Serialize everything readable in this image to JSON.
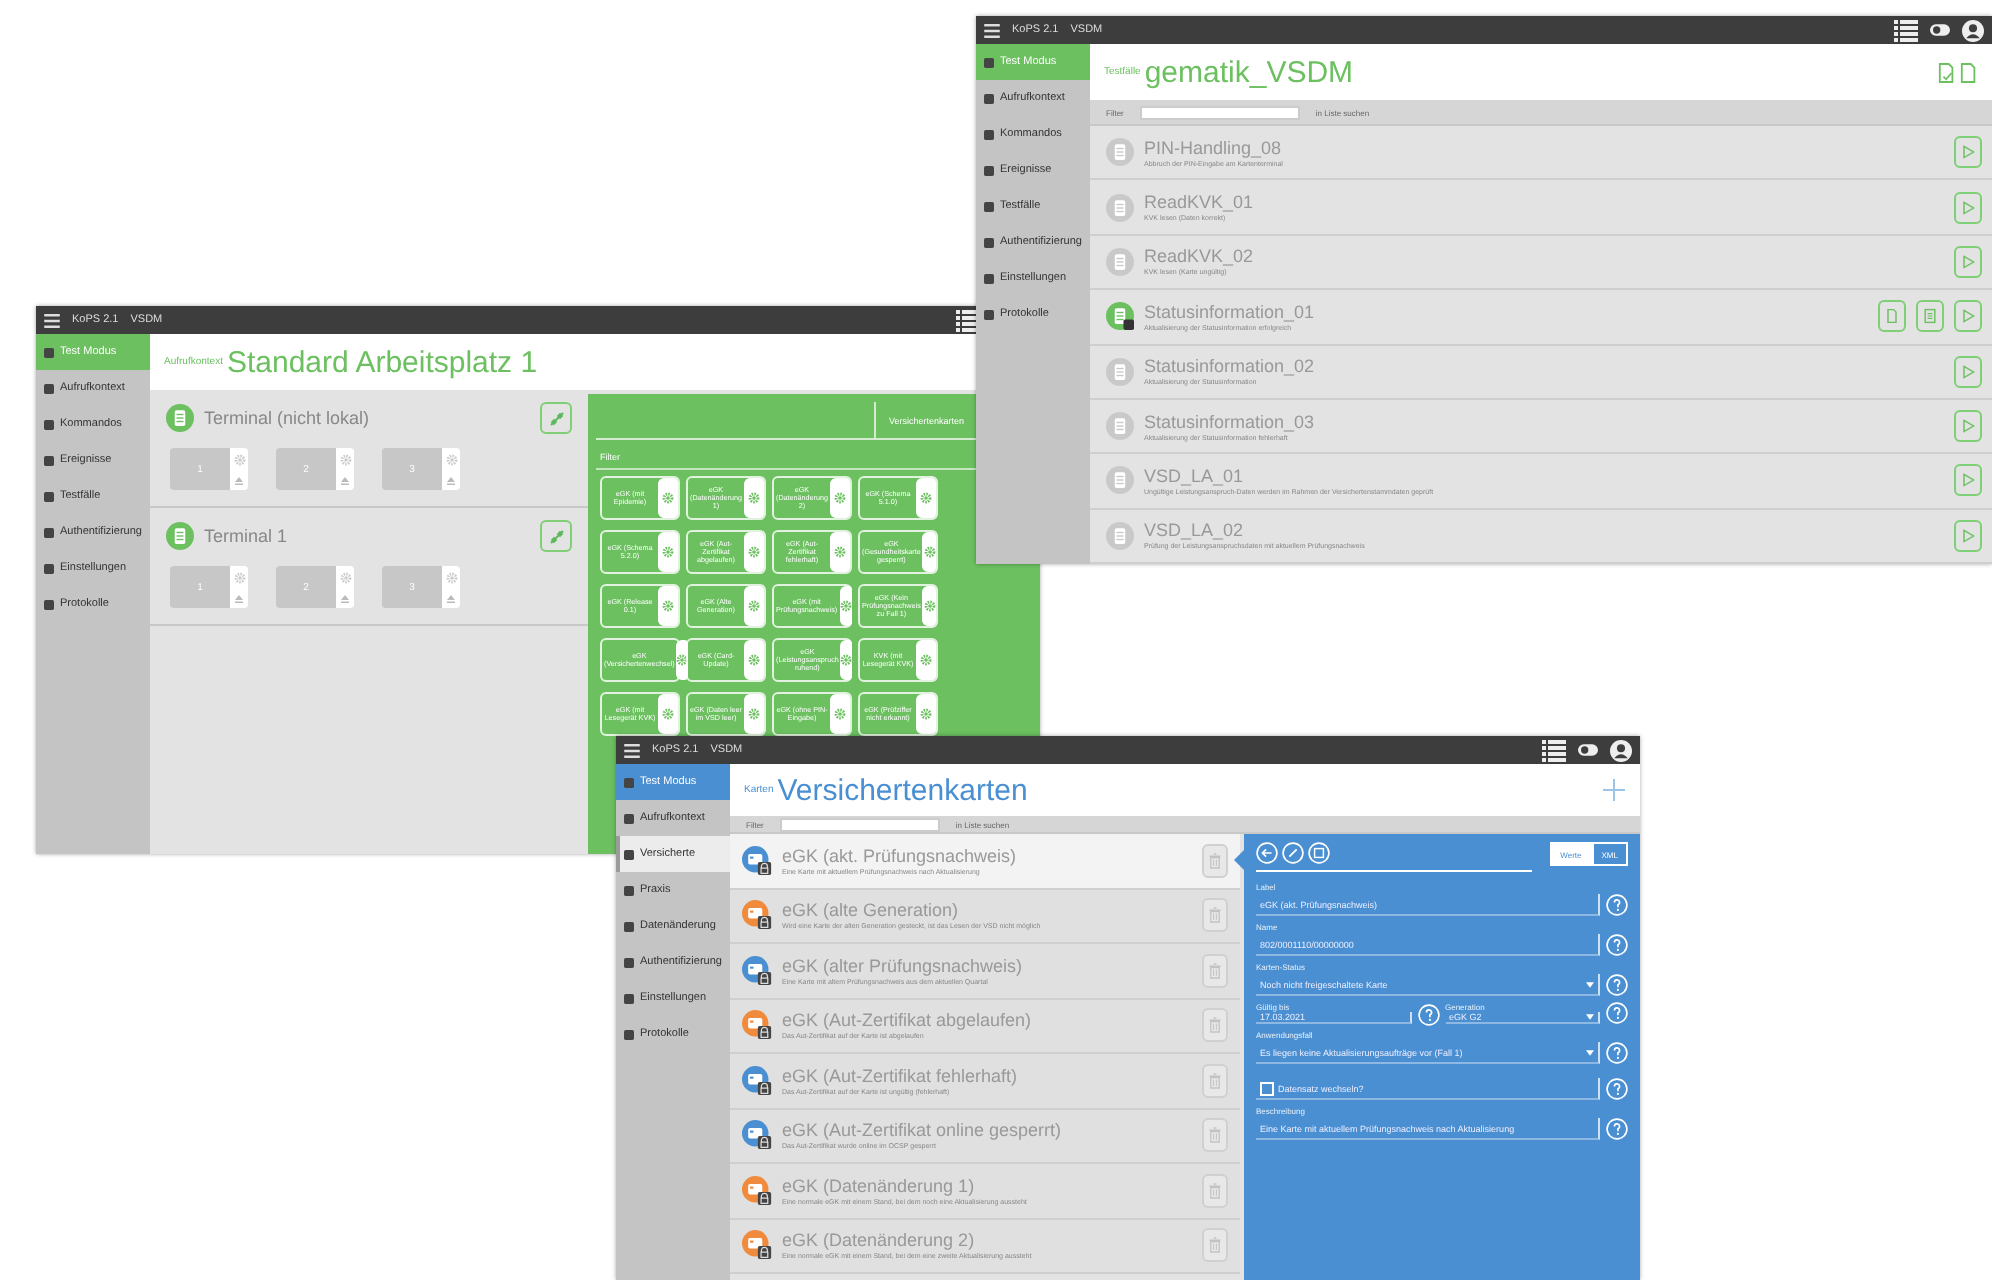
{
  "windows": [
    {
      "kind": "terminals",
      "app": "KoPS 2.1",
      "module": "VSDM",
      "breadcrumb": "Aufrufkontext",
      "title": "Standard Arbeitsplatz 1",
      "sidebar": [
        {
          "label": "Test Modus",
          "selected": true,
          "current": false
        },
        {
          "label": "Aufrufkontext",
          "selected": false,
          "current": false
        },
        {
          "label": "Kommandos",
          "selected": false,
          "current": false
        },
        {
          "label": "Ereignisse",
          "selected": false,
          "current": false
        },
        {
          "label": "Testfälle",
          "selected": false,
          "current": false
        },
        {
          "label": "Authentifizierung",
          "selected": false,
          "current": false
        },
        {
          "label": "Einstellungen",
          "selected": false,
          "current": false
        },
        {
          "label": "Protokolle",
          "selected": false,
          "current": false
        }
      ],
      "terminals": [
        {
          "name": "Terminal (nicht lokal)",
          "slots": [
            "1",
            "2",
            "3"
          ]
        },
        {
          "name": "Terminal 1",
          "slots": [
            "1",
            "2",
            "3"
          ]
        }
      ],
      "card_panel": {
        "tab": "Versichertenkarten",
        "filter_label": "Filter",
        "cards": [
          "eGK (mit Epidemie)",
          "eGK (Datenänderung 1)",
          "eGK (Datenänderung 2)",
          "eGK (Schema 5.1.0)",
          "eGK (Schema 5.2.0)",
          "eGK (Aut-Zertifikat abgelaufen)",
          "eGK (Aut-Zertifikat fehlerhaft)",
          "eGK (Gesundheitskarte gesperrt)",
          "eGK (Release 0.1)",
          "eGK (Alte Generation)",
          "eGK (mit Prüfungsnachweis)",
          "eGK (Kein Prüfungsnachweis zu Fall 1)",
          "eGK (Versichertenwechsel)",
          "eGK (Card-Update)",
          "eGK (Leistungsanspruch ruhend)",
          "KVK (mit Lesegerät KVK)",
          "eGK (mit Lesegerät KVK)",
          "eGK (Daten leer im VSD leer)",
          "eGK (ohne PIN-Eingabe)",
          "eGK (Prüfziffer nicht erkannt)"
        ]
      }
    },
    {
      "kind": "testcases",
      "app": "KoPS 2.1",
      "module": "VSDM",
      "breadcrumb": "Testfälle",
      "title": "gematik_VSDM",
      "filter_label": "Filter",
      "filter_hint": "in Liste suchen",
      "sidebar": [
        {
          "label": "Test Modus",
          "selected": true,
          "current": false
        },
        {
          "label": "Aufrufkontext",
          "selected": false,
          "current": false
        },
        {
          "label": "Kommandos",
          "selected": false,
          "current": false
        },
        {
          "label": "Ereignisse",
          "selected": false,
          "current": false
        },
        {
          "label": "Testfälle",
          "selected": false,
          "current": false
        },
        {
          "label": "Authentifizierung",
          "selected": false,
          "current": false
        },
        {
          "label": "Einstellungen",
          "selected": false,
          "current": false
        },
        {
          "label": "Protokolle",
          "selected": false,
          "current": false
        }
      ],
      "rows": [
        {
          "name": "PIN-Handling_08",
          "description": "Abbruch der PIN-Eingabe am Kartenterminal",
          "active": false
        },
        {
          "name": "ReadKVK_01",
          "description": "KVK lesen (Daten korrekt)",
          "active": false
        },
        {
          "name": "ReadKVK_02",
          "description": "KVK lesen (Karte ungültig)",
          "active": false
        },
        {
          "name": "Statusinformation_01",
          "description": "Aktualisierung der Statusinformation erfolgreich",
          "active": true
        },
        {
          "name": "Statusinformation_02",
          "description": "Aktualisierung der Statusinformation",
          "active": false
        },
        {
          "name": "Statusinformation_03",
          "description": "Aktualisierung der Statusinformation fehlerhaft",
          "active": false
        },
        {
          "name": "VSD_LA_01",
          "description": "Ungültige Leistungsanspruch-Daten werden im Rahmen der Versichertenstammdaten geprüft",
          "active": false
        },
        {
          "name": "VSD_LA_02",
          "description": "Prüfung der Leistungsanspruchsdaten mit aktuellem Prüfungsnachweis",
          "active": false
        }
      ]
    },
    {
      "kind": "cards",
      "app": "KoPS 2.1",
      "module": "VSDM",
      "breadcrumb": "Karten",
      "title": "Versichertenkarten",
      "filter_label": "Filter",
      "filter_hint": "in Liste suchen",
      "sidebar": [
        {
          "label": "Test Modus",
          "selected": true,
          "current": false
        },
        {
          "label": "Aufrufkontext",
          "selected": false,
          "current": false
        },
        {
          "label": "Versicherte",
          "selected": false,
          "current": true
        },
        {
          "label": "Praxis",
          "selected": false,
          "current": false
        },
        {
          "label": "Datenänderung",
          "selected": false,
          "current": false
        },
        {
          "label": "Authentifizierung",
          "selected": false,
          "current": false
        },
        {
          "label": "Einstellungen",
          "selected": false,
          "current": false
        },
        {
          "label": "Protokolle",
          "selected": false,
          "current": false
        }
      ],
      "rows": [
        {
          "name": "eGK (akt. Prüfungsnachweis)",
          "description": "Eine Karte mit aktuellem Prüfungsnachweis nach Aktualisierung",
          "color": "#4a8fd2",
          "selected": true
        },
        {
          "name": "eGK (alte Generation)",
          "description": "Wird eine Karte der alten Generation gesteckt, ist das Lesen der VSD nicht möglich",
          "color": "#f08a3c",
          "selected": false
        },
        {
          "name": "eGK (alter Prüfungsnachweis)",
          "description": "Eine Karte mit altem Prüfungsnachweis aus dem aktuellen Quartal",
          "color": "#4a8fd2",
          "selected": false
        },
        {
          "name": "eGK (Aut-Zertifikat abgelaufen)",
          "description": "Das Aut-Zertifikat auf der Karte ist abgelaufen",
          "color": "#f08a3c",
          "selected": false
        },
        {
          "name": "eGK (Aut-Zertifikat fehlerhaft)",
          "description": "Das Aut-Zertifikat auf der Karte ist ungültig (fehlerhaft)",
          "color": "#4a8fd2",
          "selected": false
        },
        {
          "name": "eGK (Aut-Zertifikat online gesperrt)",
          "description": "Das Aut-Zertifikat wurde online im OCSP gesperrt",
          "color": "#4a8fd2",
          "selected": false
        },
        {
          "name": "eGK (Datenänderung 1)",
          "description": "Eine normale eGK mit einem Stand, bei dem noch eine Aktualisierung aussteht",
          "color": "#f08a3c",
          "selected": false
        },
        {
          "name": "eGK (Datenänderung 2)",
          "description": "Eine normale eGK mit einem Stand, bei dem eine zweite Aktualisierung aussteht",
          "color": "#f08a3c",
          "selected": false
        }
      ],
      "detail": {
        "views": [
          {
            "label": "Werte",
            "selected": true
          },
          {
            "label": "XML",
            "selected": false
          }
        ],
        "fields": [
          {
            "kind": "text",
            "label": "Label",
            "value": "eGK (akt. Prüfungsnachweis)"
          },
          {
            "kind": "text",
            "label": "Name",
            "value": "802/0001110/00000000"
          },
          {
            "kind": "select",
            "label": "Karten-Status",
            "value": "Noch nicht freigeschaltete Karte"
          },
          {
            "kind": "pair",
            "left": {
              "kind": "text",
              "label": "Gültig bis",
              "value": "17.03.2021"
            },
            "right": {
              "kind": "select",
              "label": "Generation",
              "value": "eGK G2"
            }
          },
          {
            "kind": "select",
            "label": "Anwendungsfall",
            "value": "Es liegen keine Aktualisierungsaufträge vor (Fall 1)"
          },
          {
            "kind": "checkbox",
            "label": "Datensatz wechseln?",
            "checked": false
          },
          {
            "kind": "textarea",
            "label": "Beschreibung",
            "value": "Eine Karte mit aktuellem Prüfungsnachweis nach Aktualisierung"
          }
        ]
      }
    }
  ]
}
